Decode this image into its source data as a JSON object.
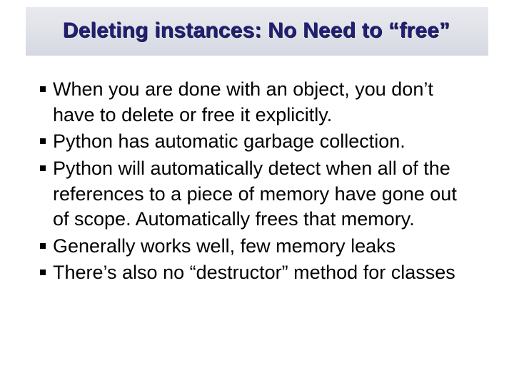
{
  "slide": {
    "title": "Deleting instances: No Need to “free”",
    "bullets": [
      "When you are done with an object, you don’t have to delete or free it explicitly.",
      "Python has automatic garbage collection.",
      "Python will automatically detect when all of the references to a piece of memory have gone out of scope.  Automatically frees that memory.",
      "Generally works well, few memory leaks",
      "There’s also no “destructor” method for classes"
    ]
  }
}
